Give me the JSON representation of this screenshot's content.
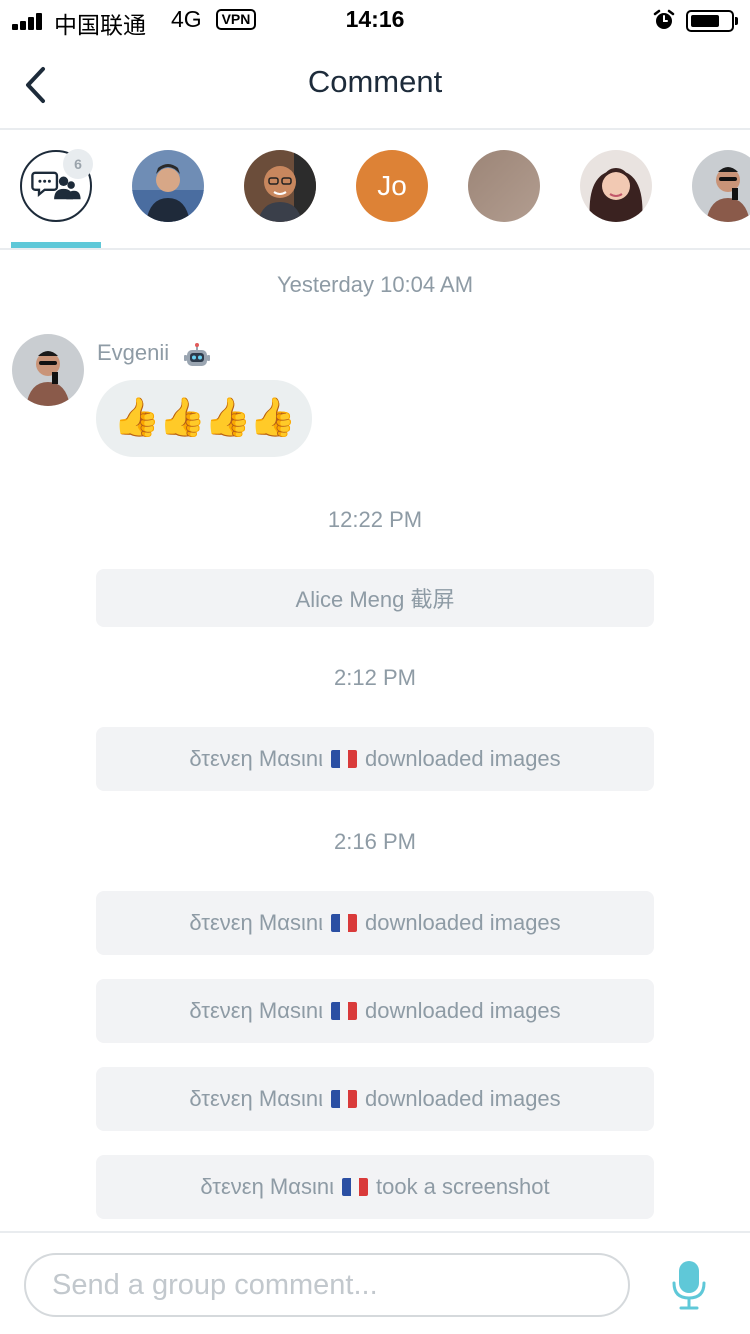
{
  "status_bar": {
    "carrier": "中国联通",
    "network": "4G",
    "vpn": "VPN",
    "time": "14:16"
  },
  "header": {
    "title": "Comment"
  },
  "participants": {
    "group_badge": "6",
    "items": [
      {
        "type": "photo",
        "initials": ""
      },
      {
        "type": "photo",
        "initials": ""
      },
      {
        "type": "initials",
        "initials": "Jo",
        "color": "#dd8236"
      },
      {
        "type": "photo",
        "initials": ""
      },
      {
        "type": "photo",
        "initials": ""
      },
      {
        "type": "photo",
        "initials": ""
      }
    ]
  },
  "messages": {
    "time_1": "Yesterday 10:04 AM",
    "sender_1": "Evgenii",
    "bubble_1": "👍👍👍👍",
    "time_2": "12:22 PM",
    "event_1": "Alice Meng 截屏",
    "time_3": "2:12 PM",
    "event_2_name": "δτενεη Μαsιnι",
    "event_2_action": "downloaded images",
    "time_4": "2:16 PM",
    "event_3_name": "δτενεη Μαsιnι",
    "event_3_action": "downloaded images",
    "event_4_name": "δτενεη Μαsιnι",
    "event_4_action": "downloaded images",
    "event_5_name": "δτενεη Μαsιnι",
    "event_5_action": "downloaded images",
    "event_6_name": "δτενεη Μαsιnι",
    "event_6_action": "took a screenshot"
  },
  "composer": {
    "placeholder": "Send a group comment...",
    "value": ""
  },
  "colors": {
    "accent": "#5fc8d8",
    "text_dark": "#1d2b3a",
    "text_muted": "#8e9ba5",
    "system_bg": "#f2f3f5",
    "bubble_bg": "#ebeff0"
  },
  "icons": {
    "back": "chevron-left-icon",
    "group": "group-chat-icon",
    "mic": "microphone-icon",
    "alarm": "alarm-icon",
    "bot": "robot-icon",
    "flag": "france-flag-icon"
  }
}
